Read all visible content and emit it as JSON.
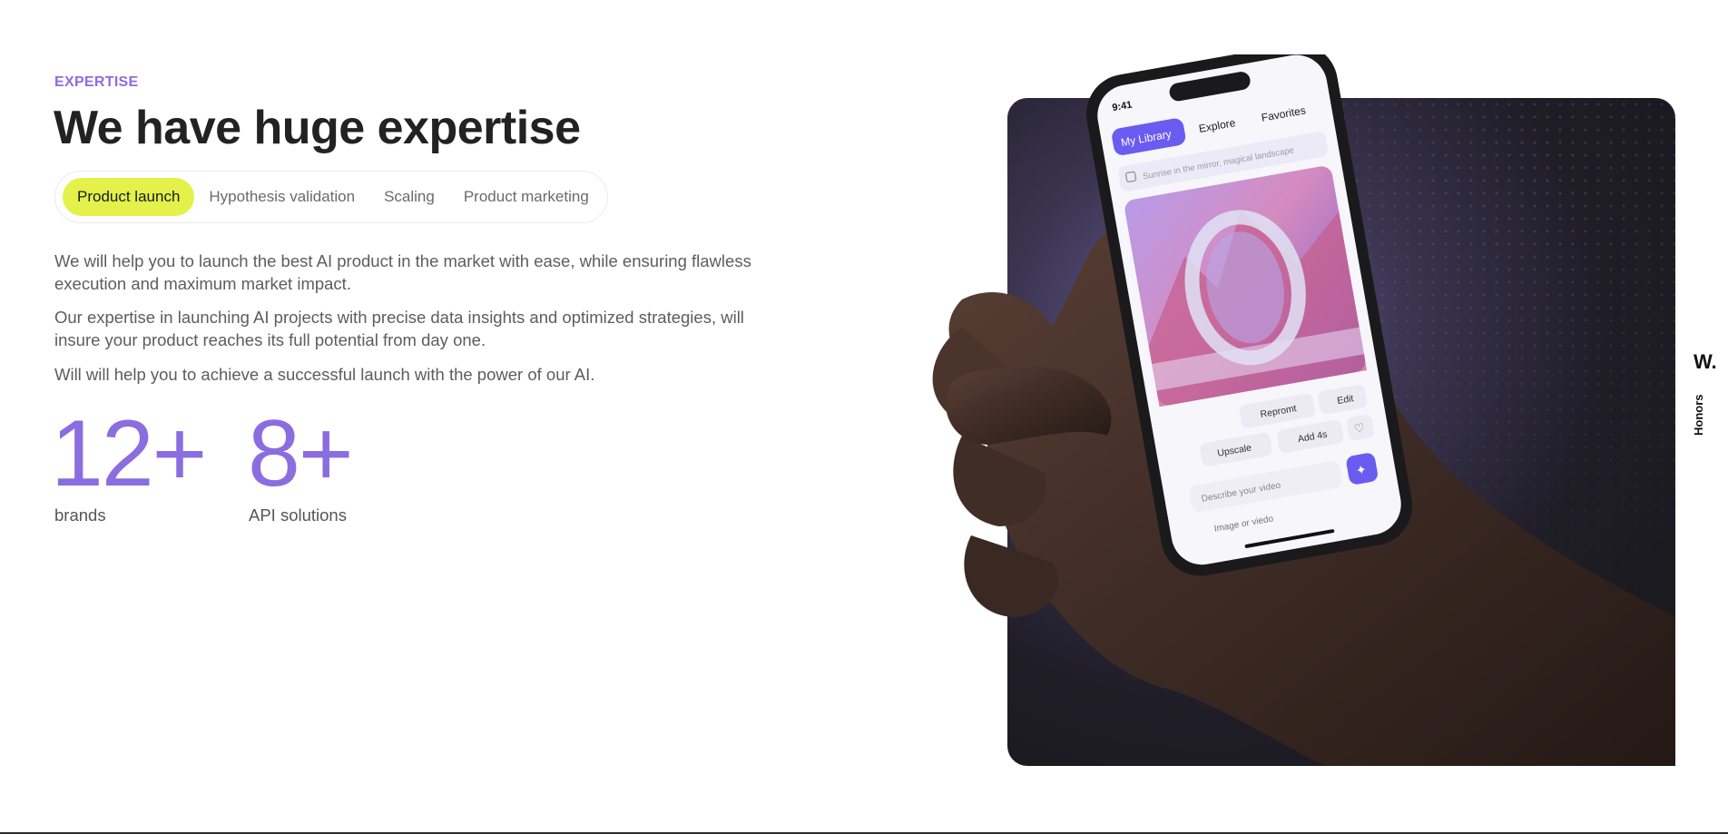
{
  "section": {
    "eyebrow": "EXPERTISE",
    "title": "We have huge expertise"
  },
  "tabs": [
    {
      "label": "Product launch",
      "active": true
    },
    {
      "label": "Hypothesis validation",
      "active": false
    },
    {
      "label": "Scaling",
      "active": false
    },
    {
      "label": "Product marketing",
      "active": false
    }
  ],
  "paragraphs": [
    "We will help you to launch the best AI product in the market with ease, while ensuring flawless execution and maximum market impact.",
    "Our expertise in launching AI projects with precise data insights and optimized strategies, will insure your product reaches its full potential from day one.",
    "Will will help you to achieve a successful launch with the power of our AI."
  ],
  "stats": [
    {
      "value": "12+",
      "label": "brands"
    },
    {
      "value": "8+",
      "label": "API solutions"
    }
  ],
  "phone": {
    "time": "9:41",
    "tabs": [
      "My Library",
      "Explore",
      "Favorites"
    ],
    "prompt": "Sunrise in the mirror, magical landscape",
    "actions": [
      "Repromt",
      "Edit",
      "Upscale",
      "Add 4s"
    ],
    "input_placeholder": "Describe your video",
    "attach_label": "Image or viedo"
  },
  "side": {
    "logo": "W.",
    "honors": "Honors"
  },
  "colors": {
    "accent": "#8b6de0",
    "active_tab": "#e3f14a",
    "phone_button": "#6a5cf0"
  }
}
